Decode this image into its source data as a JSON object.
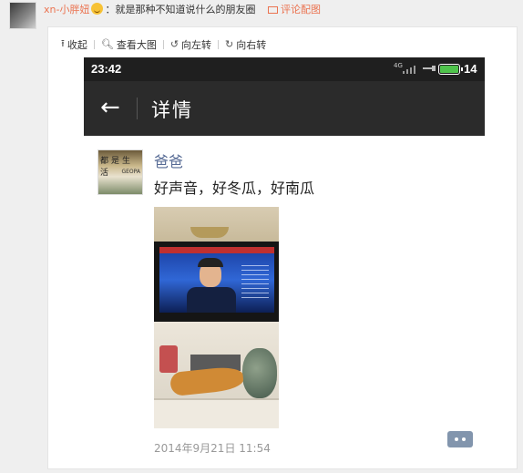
{
  "post": {
    "username": "xn-小胖妞",
    "text": "：就是那种不知道说什么的朋友圈",
    "comment_image_link": "评论配图"
  },
  "toolbar": {
    "collapse_label": "收起",
    "view_large_label": "查看大图",
    "rotate_left_label": "向左转",
    "rotate_right_label": "向右转"
  },
  "phone": {
    "status_time": "23:42",
    "network": "4G",
    "battery_level": "14",
    "battery_fill": 1.0,
    "title": "详情",
    "back_glyph": "←"
  },
  "moment": {
    "avatar_text": "都是生活",
    "avatar_subtext": "GEOPA",
    "author": "爸爸",
    "message": "好声音，好冬瓜，好南瓜",
    "timestamp": "2014年9月21日 11:54"
  },
  "colors": {
    "accent": "#eb7350",
    "author_link": "#576b95",
    "titlebar": "#2b2b2b",
    "comment_button": "#8295ad"
  }
}
